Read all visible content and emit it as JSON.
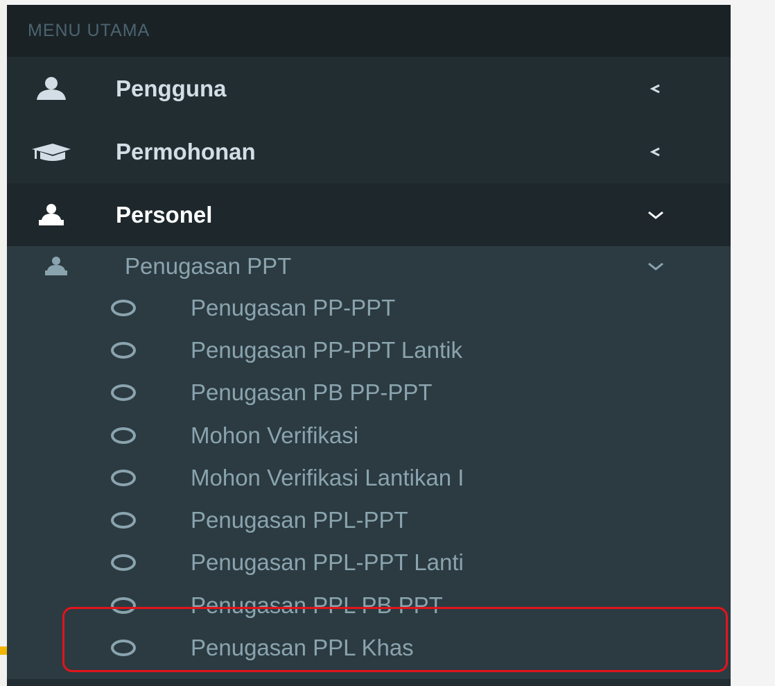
{
  "sidebar": {
    "header": "MENU UTAMA",
    "items": [
      {
        "label": "Pengguna",
        "icon": "user-icon",
        "chevron": "chevron-left-icon"
      },
      {
        "label": "Permohonan",
        "icon": "graduation-cap-icon",
        "chevron": "chevron-left-icon"
      },
      {
        "label": "Personel",
        "icon": "sitemap-icon",
        "chevron": "chevron-down-icon",
        "active": true
      }
    ],
    "submenu": {
      "label": "Penugasan PPT",
      "icon": "sitemap-icon",
      "items": [
        {
          "label": "Penugasan PP-PPT"
        },
        {
          "label": "Penugasan PP-PPT Lantik"
        },
        {
          "label": "Penugasan PB PP-PPT",
          "highlighted": true
        },
        {
          "label": "Mohon Verifikasi"
        },
        {
          "label": "Mohon Verifikasi Lantikan I"
        },
        {
          "label": "Penugasan PPL-PPT"
        },
        {
          "label": "Penugasan PPL-PPT Lanti"
        },
        {
          "label": "Penugasan PPL PB PPT"
        },
        {
          "label": "Penugasan PPL Khas"
        }
      ]
    }
  },
  "colors": {
    "sidebar_bg": "#222d32",
    "header_bg": "#1a2226",
    "submenu_bg": "#2c3b41",
    "highlight": "#e3141b",
    "accent": "#f2b600"
  }
}
